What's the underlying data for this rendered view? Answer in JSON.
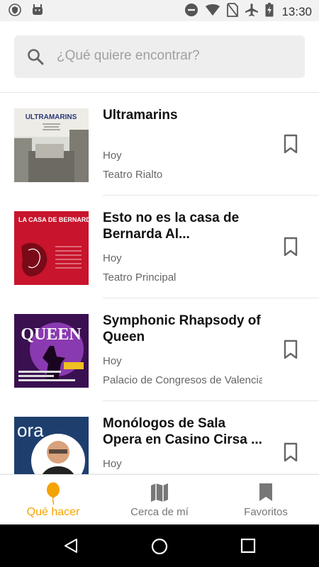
{
  "status_bar": {
    "time": "13:30",
    "icons": [
      "shield-icon",
      "android-icon",
      "do-not-disturb-icon",
      "wifi-icon",
      "no-sim-icon",
      "airplane-icon",
      "battery-charging-icon"
    ]
  },
  "search": {
    "placeholder": "¿Qué quiere encontrar?",
    "icon": "search-icon"
  },
  "events": [
    {
      "title": "Ultramarins",
      "date": "Hoy",
      "venue": "Teatro Rialto",
      "poster_text": "ULTRAMARINS"
    },
    {
      "title": "Esto no es la casa de Bernarda Al...",
      "date": "Hoy",
      "venue": "Teatro Principal",
      "poster_text": "LA CASA DE BERNARDA ALBA"
    },
    {
      "title": "Symphonic Rhapsody of Queen",
      "date": "Hoy",
      "venue": "Palacio de Congresos de Valencia",
      "poster_text": "QUEEN"
    },
    {
      "title": "Monólogos de Sala Opera en Casino Cirsa ...",
      "date": "Hoy",
      "venue": "",
      "poster_text": "ora"
    }
  ],
  "tabs": [
    {
      "label": "Qué hacer",
      "icon": "balloon-icon",
      "active": true
    },
    {
      "label": "Cerca de mí",
      "icon": "map-icon",
      "active": false
    },
    {
      "label": "Favoritos",
      "icon": "bookmark-icon",
      "active": false
    }
  ],
  "colors": {
    "accent": "#f5a300",
    "search_bg": "#eeeeee",
    "status_bg": "#f2f2f2"
  }
}
